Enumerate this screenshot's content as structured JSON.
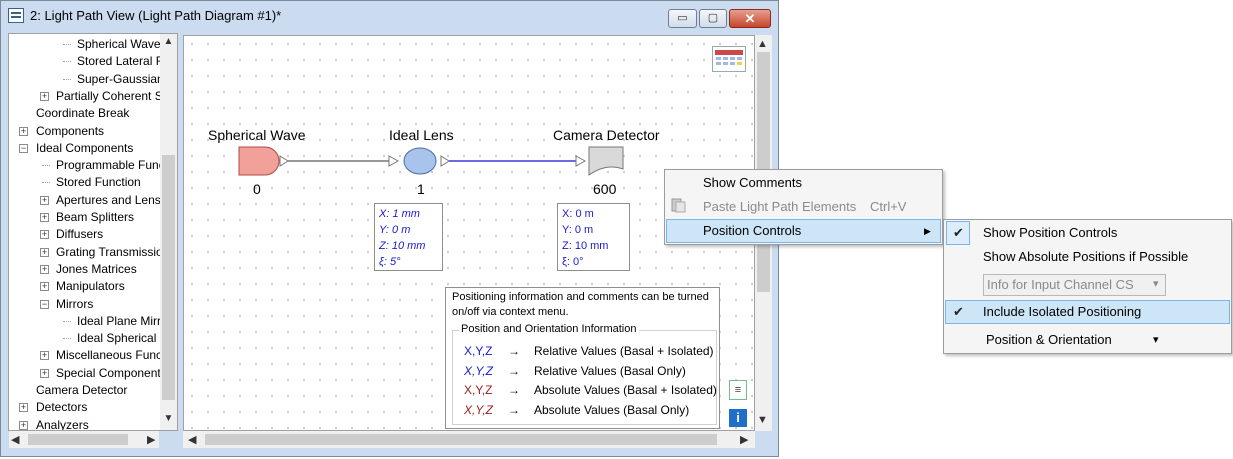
{
  "window": {
    "title": "2: Light Path View (Light Path Diagram #1)*",
    "controls": {
      "minimize": "▭",
      "maximize": "▢",
      "close": "✕"
    }
  },
  "tree": {
    "items": [
      {
        "label": "Spherical Wave",
        "indent": 3,
        "expander": ""
      },
      {
        "label": "Stored Lateral Fi",
        "indent": 3,
        "expander": ""
      },
      {
        "label": "Super-Gaussian",
        "indent": 3,
        "expander": ""
      },
      {
        "label": "Partially Coherent Sc",
        "indent": 2,
        "expander": "+"
      },
      {
        "label": "Coordinate Break",
        "indent": 1,
        "expander": ""
      },
      {
        "label": "Components",
        "indent": 0,
        "expander": "+"
      },
      {
        "label": "Ideal Components",
        "indent": 0,
        "expander": "−"
      },
      {
        "label": "Programmable Funct",
        "indent": 2,
        "expander": ""
      },
      {
        "label": "Stored Function",
        "indent": 2,
        "expander": ""
      },
      {
        "label": "Apertures and Lense",
        "indent": 2,
        "expander": "+"
      },
      {
        "label": "Beam Splitters",
        "indent": 2,
        "expander": "+"
      },
      {
        "label": "Diffusers",
        "indent": 2,
        "expander": "+"
      },
      {
        "label": "Grating Transmissio",
        "indent": 2,
        "expander": "+"
      },
      {
        "label": "Jones Matrices",
        "indent": 2,
        "expander": "+"
      },
      {
        "label": "Manipulators",
        "indent": 2,
        "expander": "+"
      },
      {
        "label": "Mirrors",
        "indent": 2,
        "expander": "−"
      },
      {
        "label": "Ideal Plane Mirro",
        "indent": 3,
        "expander": ""
      },
      {
        "label": "Ideal Spherical M",
        "indent": 3,
        "expander": ""
      },
      {
        "label": "Miscellaneous Funct",
        "indent": 2,
        "expander": "+"
      },
      {
        "label": "Special Components",
        "indent": 2,
        "expander": "+"
      },
      {
        "label": "Camera Detector",
        "indent": 1,
        "expander": ""
      },
      {
        "label": "Detectors",
        "indent": 0,
        "expander": "+"
      },
      {
        "label": "Analyzers",
        "indent": 0,
        "expander": "+"
      }
    ]
  },
  "diagram": {
    "elements": [
      {
        "name": "Spherical Wave",
        "index": "0"
      },
      {
        "name": "Ideal Lens",
        "index": "1"
      },
      {
        "name": "Camera Detector",
        "index": "600"
      }
    ],
    "lens_info": {
      "x": "X: 1 mm",
      "y": "Y: 0 m",
      "z": "Z: 10 mm",
      "xi": "ξ: 5°"
    },
    "detector_info": {
      "x": "X: 0 m",
      "y": "Y: 0 m",
      "z": "Z: 10 mm",
      "xi": "ξ: 0°"
    },
    "colors": {
      "source": "#f2a09a",
      "lens": "#a9c4ec",
      "detector": "#d9d9d9",
      "link_blue": "#3b3bd8",
      "link_gray": "#777777"
    }
  },
  "legend": {
    "intro": "Positioning information and comments can be turned on/off via context menu.",
    "group_title": "Position and Orientation Information",
    "rows": [
      {
        "key": "X,Y,Z",
        "arrow": "→",
        "desc": "Relative Values (Basal + Isolated)",
        "color": "#1a1ad0",
        "italic": false
      },
      {
        "key": "X,Y,Z",
        "arrow": "→",
        "desc": "Relative Values (Basal Only)",
        "color": "#1a1ad0",
        "italic": true
      },
      {
        "key": "X,Y,Z",
        "arrow": "→",
        "desc": "Absolute Values (Basal + Isolated)",
        "color": "#9c1c1c",
        "italic": false
      },
      {
        "key": "X,Y,Z",
        "arrow": "→",
        "desc": "Absolute Values (Basal Only)",
        "color": "#9c1c1c",
        "italic": true
      }
    ]
  },
  "context_menu": {
    "show_comments": "Show Comments",
    "paste": "Paste Light Path Elements",
    "paste_shortcut": "Ctrl+V",
    "position_controls": "Position Controls",
    "submenu_arrow": "▶"
  },
  "submenu": {
    "show_position_controls": "Show Position Controls",
    "show_absolute": "Show Absolute Positions if Possible",
    "info_combo": "Info for Input Channel CS",
    "include_isolated": "Include Isolated Positioning",
    "position_orientation": "Position & Orientation",
    "check": "✔",
    "dropdown": "▾"
  }
}
